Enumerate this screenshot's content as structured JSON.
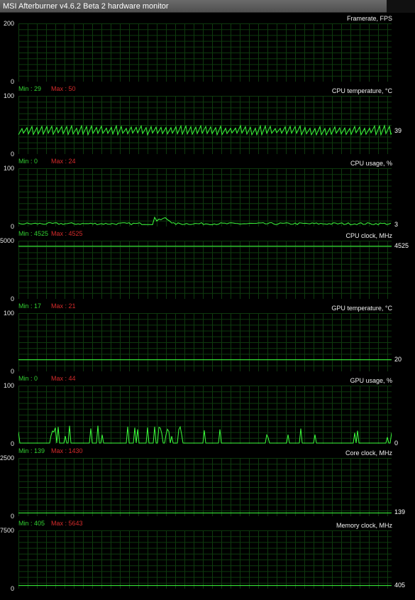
{
  "window": {
    "title": "MSI Afterburner v4.6.2 Beta 2 hardware monitor"
  },
  "colors": {
    "grid": "#0e3a0e",
    "trace": "#3cff3c",
    "min_text": "#31d031",
    "max_text": "#d52b2b",
    "axis_text": "#e6e6e6"
  },
  "graphs": [
    {
      "name": "Framerate, FPS",
      "y_max": "200",
      "y_min": "0",
      "min_label": "Min : 29",
      "max_label": "Max : 50",
      "current": "",
      "shape": "none"
    },
    {
      "name": "CPU temperature, °C",
      "y_max": "100",
      "y_min": "0",
      "min_label": "Min : 0",
      "max_label": "Max : 24",
      "current": "39",
      "value": 39,
      "shape": "sawtooth"
    },
    {
      "name": "CPU usage, %",
      "y_max": "100",
      "y_min": "0",
      "min_label": "Min : 4525",
      "max_label": "Max : 4525",
      "current": "3",
      "value": 3,
      "shape": "noise"
    },
    {
      "name": "CPU clock, MHz",
      "y_max": "5000",
      "y_min": "0",
      "min_label": "Min : 17",
      "max_label": "Max : 21",
      "current": "4525",
      "value": 4525,
      "shape": "flat"
    },
    {
      "name": "GPU temperature, °C",
      "y_max": "100",
      "y_min": "0",
      "min_label": "Min : 0",
      "max_label": "Max : 44",
      "current": "20",
      "value": 20,
      "shape": "flat"
    },
    {
      "name": "GPU usage, %",
      "y_max": "100",
      "y_min": "0",
      "min_label": "Min : 139",
      "max_label": "Max : 1430",
      "current": "0",
      "value": 0,
      "shape": "spikes"
    },
    {
      "name": "Core clock, MHz",
      "y_max": "2500",
      "y_min": "0",
      "min_label": "Min : 405",
      "max_label": "Max : 5643",
      "current": "139",
      "value": 139,
      "shape": "flat"
    },
    {
      "name": "Memory clock, MHz",
      "y_max": "7500",
      "y_min": "0",
      "min_label": "",
      "max_label": "",
      "current": "405",
      "value": 405,
      "shape": "flat"
    }
  ]
}
